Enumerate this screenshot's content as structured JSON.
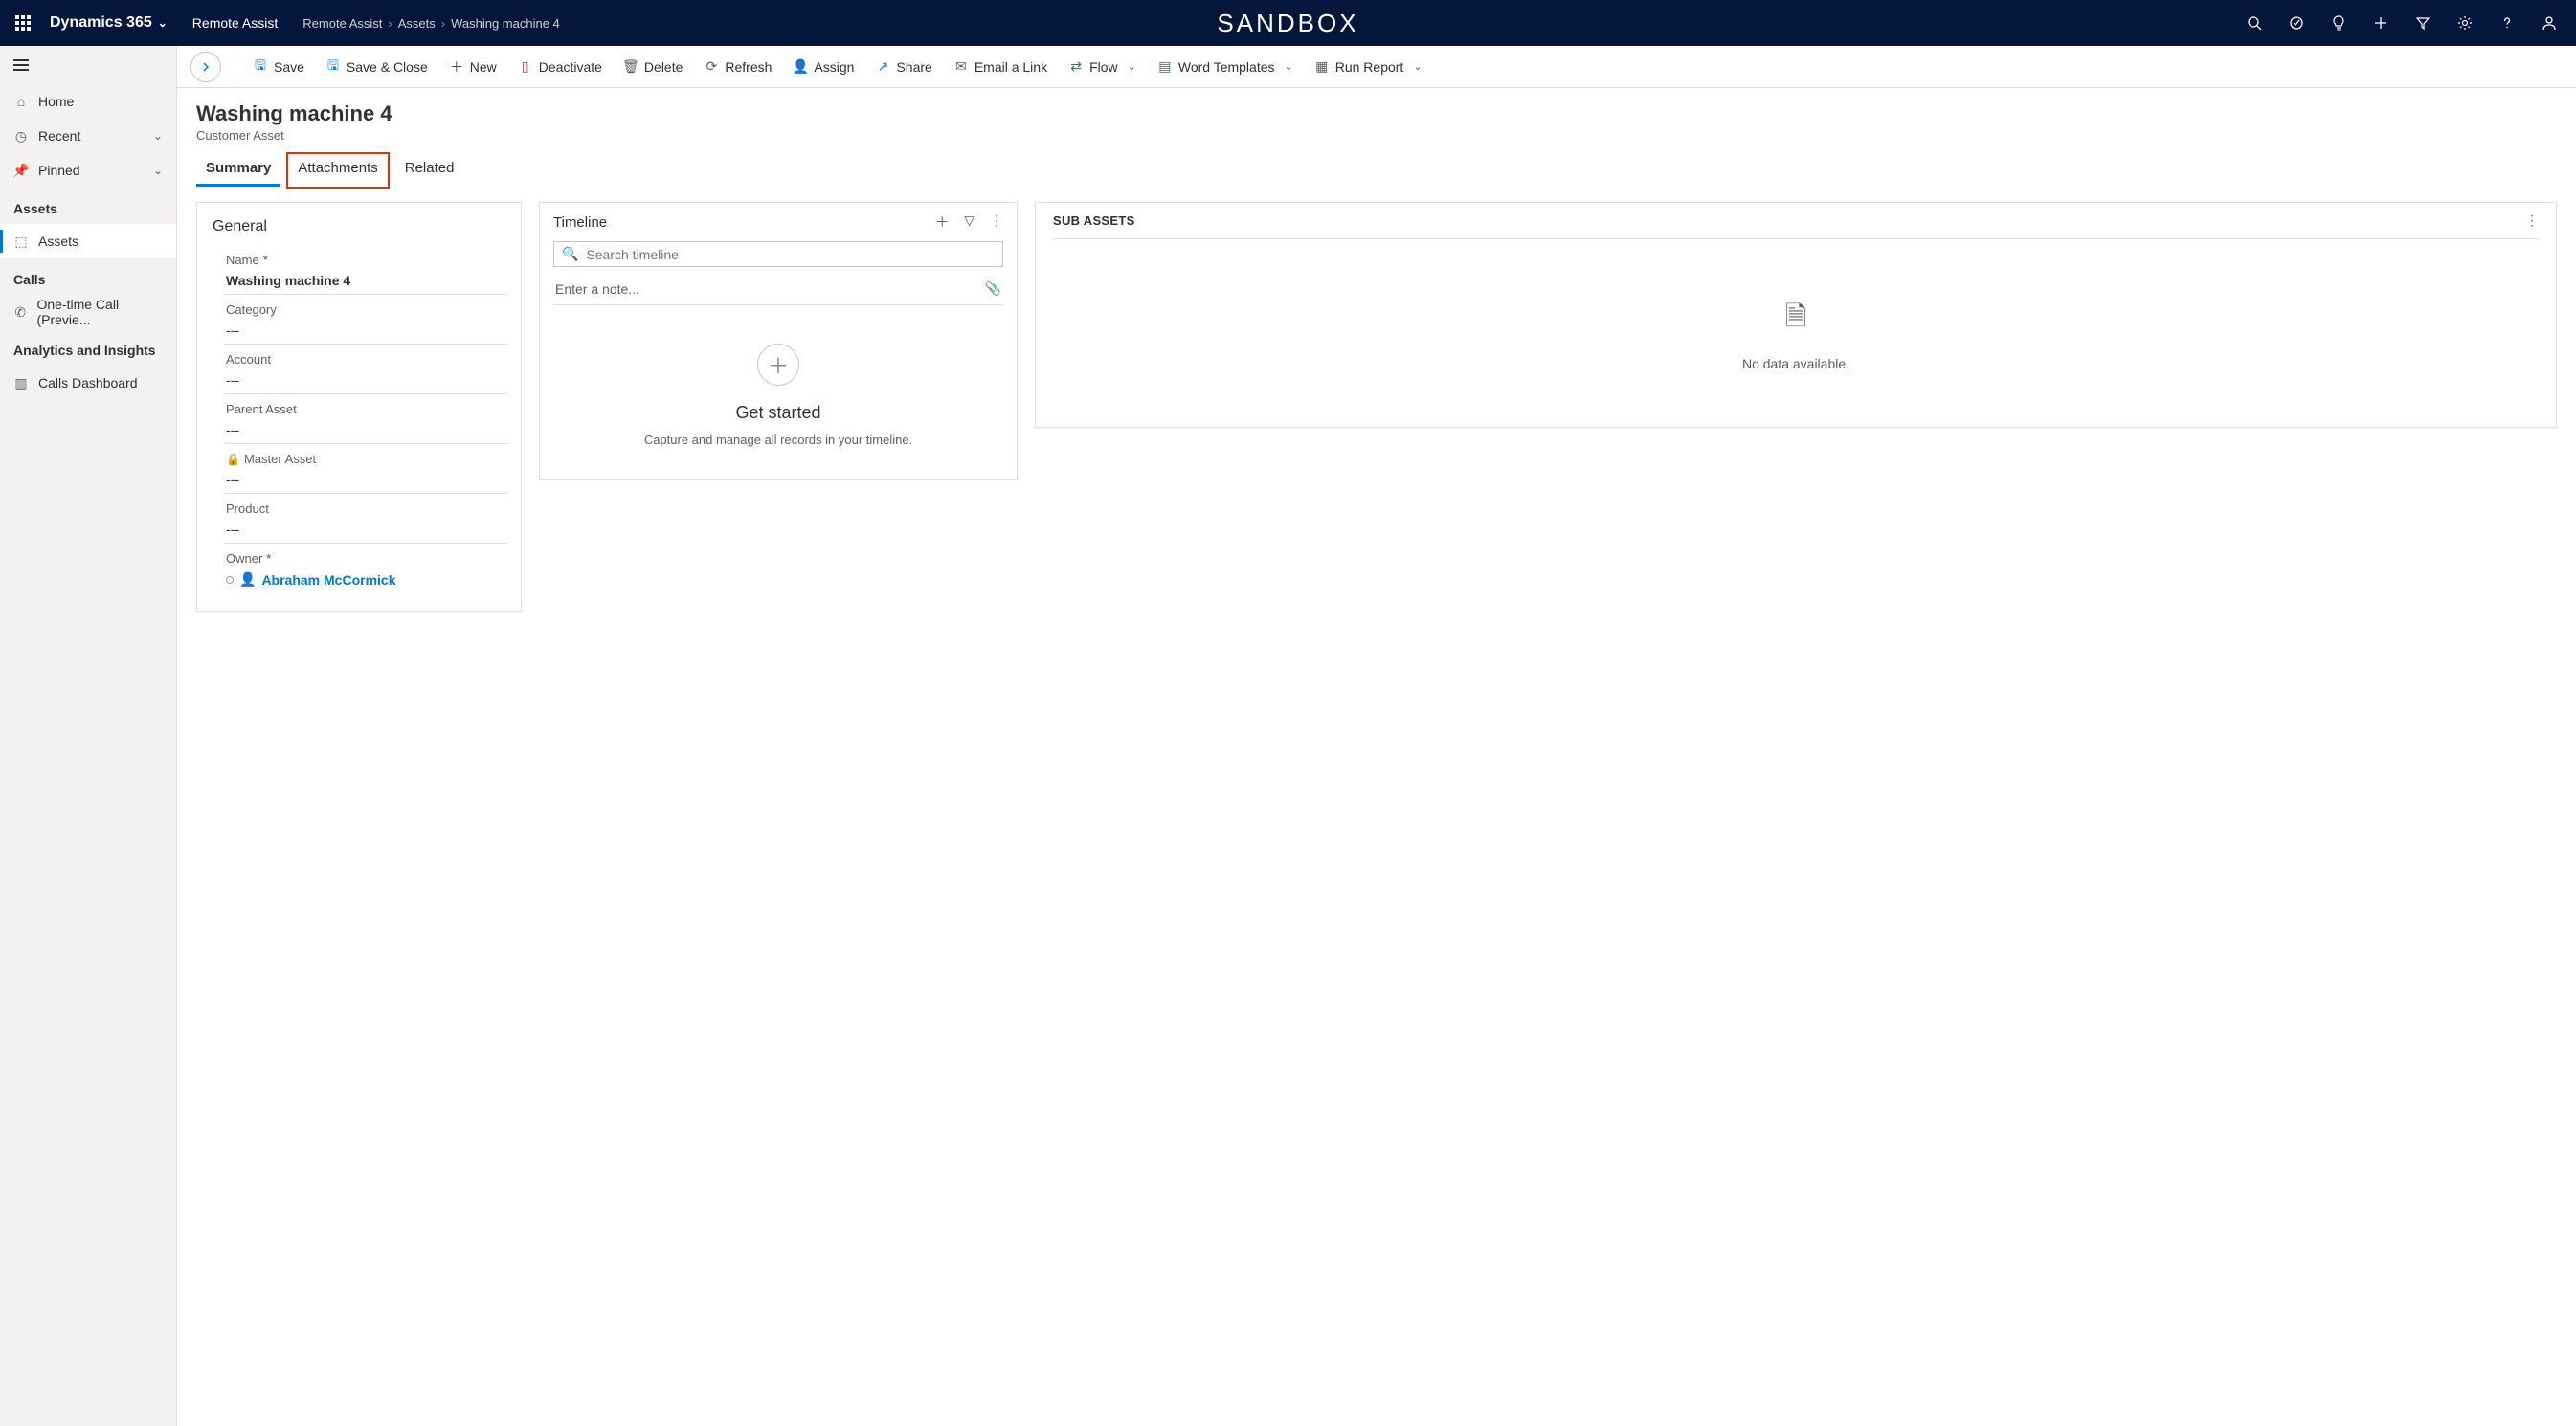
{
  "topbar": {
    "brand": "Dynamics 365",
    "app": "Remote Assist",
    "breadcrumb": [
      "Remote Assist",
      "Assets",
      "Washing machine 4"
    ],
    "sandbox": "SANDBOX"
  },
  "sidebar": {
    "home": "Home",
    "recent": "Recent",
    "pinned": "Pinned",
    "groups": [
      {
        "header": "Assets",
        "items": [
          {
            "label": "Assets",
            "active": true
          }
        ]
      },
      {
        "header": "Calls",
        "items": [
          {
            "label": "One-time Call (Previe...",
            "active": false
          }
        ]
      },
      {
        "header": "Analytics and Insights",
        "items": [
          {
            "label": "Calls Dashboard",
            "active": false
          }
        ]
      }
    ]
  },
  "commands": {
    "save": "Save",
    "saveClose": "Save & Close",
    "new": "New",
    "deactivate": "Deactivate",
    "delete": "Delete",
    "refresh": "Refresh",
    "assign": "Assign",
    "share": "Share",
    "emailLink": "Email a Link",
    "flow": "Flow",
    "wordTemplates": "Word Templates",
    "runReport": "Run Report"
  },
  "record": {
    "title": "Washing machine  4",
    "subtitle": "Customer Asset",
    "tabs": {
      "summary": "Summary",
      "attachments": "Attachments",
      "related": "Related"
    }
  },
  "general": {
    "section": "General",
    "fields": {
      "name": {
        "label": "Name",
        "required": true,
        "value": "Washing machine  4"
      },
      "category": {
        "label": "Category",
        "required": false,
        "value": "---"
      },
      "account": {
        "label": "Account",
        "required": false,
        "value": "---"
      },
      "parentAsset": {
        "label": "Parent Asset",
        "required": false,
        "value": "---"
      },
      "masterAsset": {
        "label": "Master Asset",
        "required": false,
        "locked": true,
        "value": "---"
      },
      "product": {
        "label": "Product",
        "required": false,
        "value": "---"
      },
      "owner": {
        "label": "Owner",
        "required": true,
        "value": "Abraham McCormick"
      }
    }
  },
  "timeline": {
    "title": "Timeline",
    "searchPlaceholder": "Search timeline",
    "notePlaceholder": "Enter a note...",
    "emptyTitle": "Get started",
    "emptySub": "Capture and manage all records in your timeline."
  },
  "subAssets": {
    "title": "SUB ASSETS",
    "empty": "No data available."
  }
}
